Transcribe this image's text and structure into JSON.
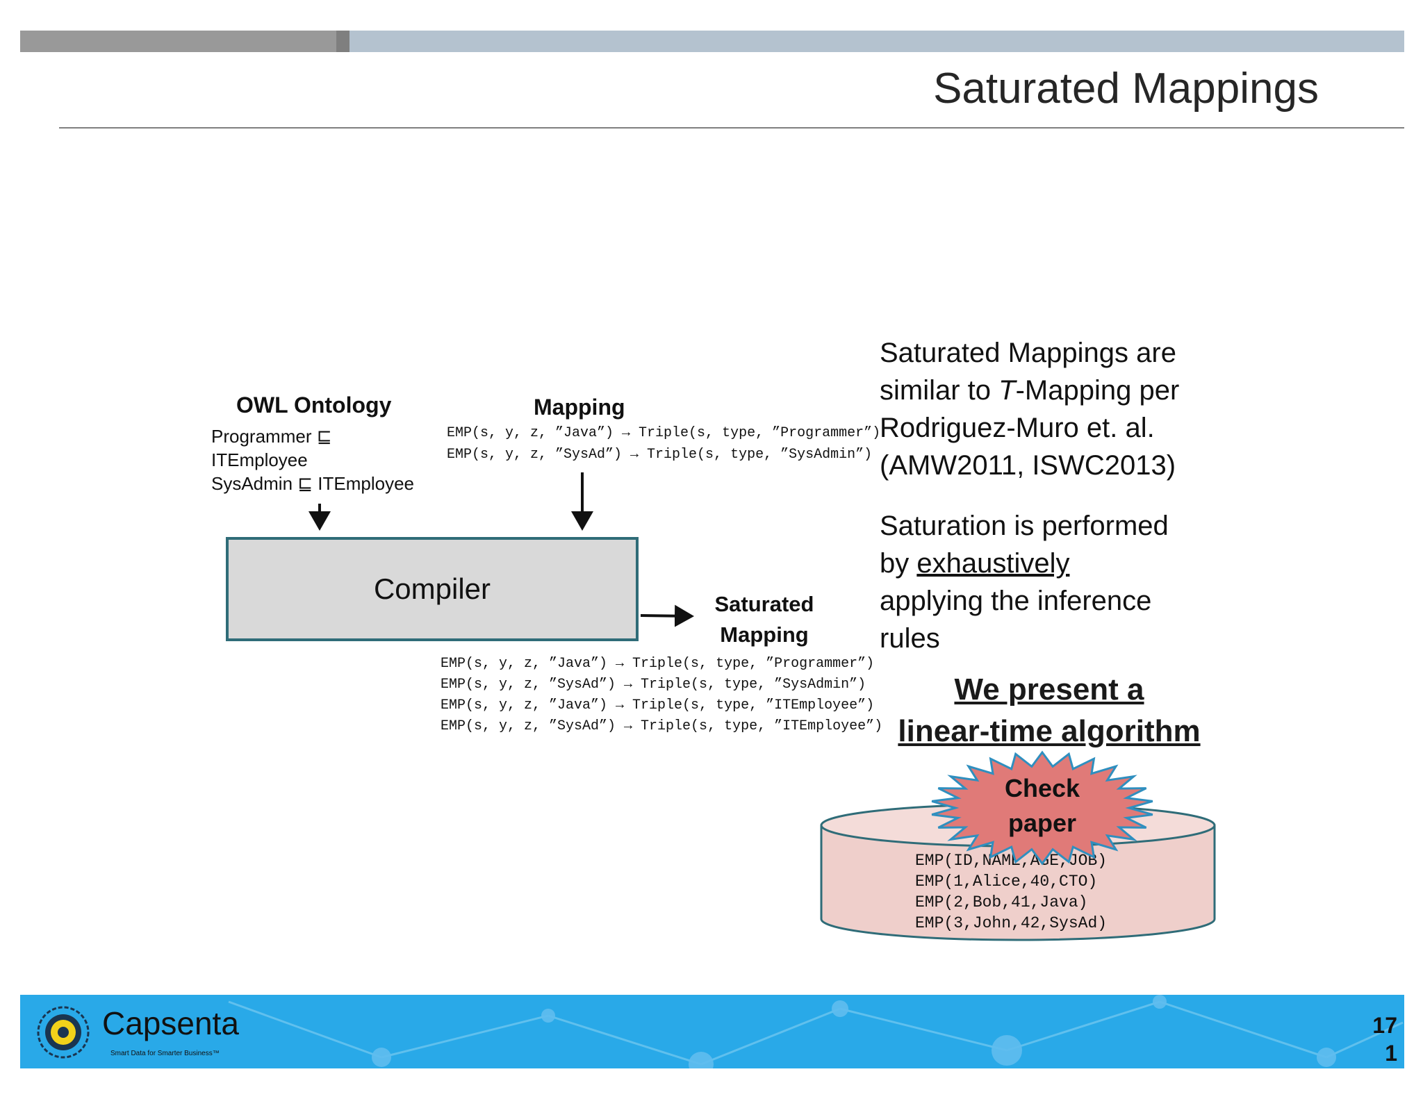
{
  "slide": {
    "title": "Saturated Mappings",
    "page_number_line1": "17",
    "page_number_line2": "1"
  },
  "diagram": {
    "ontology": {
      "heading": "OWL Ontology",
      "axiom_1a": "Programmer ⊑",
      "axiom_1b": "ITEmployee",
      "axiom_2": "SysAdmin ⊑ ITEmployee"
    },
    "mapping": {
      "heading": "Mapping",
      "rules": [
        "EMP(s, y, z, ”Java”) → Triple(s, type, ”Programmer”)",
        "EMP(s, y, z, ”SysAd”) → Triple(s, type, ”SysAdmin”)"
      ]
    },
    "compiler_label": "Compiler",
    "saturated": {
      "heading_line1": "Saturated",
      "heading_line2": "Mapping",
      "rules": [
        "EMP(s, y, z, ”Java”) → Triple(s, type, ”Programmer”)",
        "EMP(s, y, z, ”SysAd”) → Triple(s, type, ”SysAdmin”)",
        "EMP(s, y, z, ”Java”) → Triple(s, type, ”ITEmployee”)",
        "EMP(s, y, z, ”SysAd”) → Triple(s, type, ”ITEmployee”)"
      ]
    }
  },
  "right_panel": {
    "p1_a": "Saturated Mappings are similar to ",
    "p1_t": "T",
    "p1_b": "-Mapping per Rodriguez-Muro et. al. (AMW2011, ISWC2013)",
    "p2_a": "Saturation is performed by ",
    "p2_u": "exhaustively",
    "p2_b": " applying the inference rules",
    "headline_1": "We present a",
    "headline_2": "linear-time algorithm"
  },
  "database": {
    "badge_line1": "Check",
    "badge_line2": "paper",
    "rows": [
      "EMP(ID,NAME,AGE,JOB)",
      "EMP(1,Alice,40,CTO)",
      "EMP(2,Bob,41,Java)",
      "EMP(3,John,42,SysAd)"
    ]
  },
  "footer": {
    "brand": "Capsenta",
    "tagline": "Smart Data for Smarter Business™"
  },
  "colors": {
    "footer_bg": "#29a9e8",
    "compiler_fill": "#d9d9d9",
    "compiler_border": "#2f6c78",
    "cylinder_fill": "#efcfcb",
    "cylinder_stroke": "#2f6c78",
    "badge_fill": "#e07a78",
    "badge_stroke": "#2f8fbf"
  }
}
